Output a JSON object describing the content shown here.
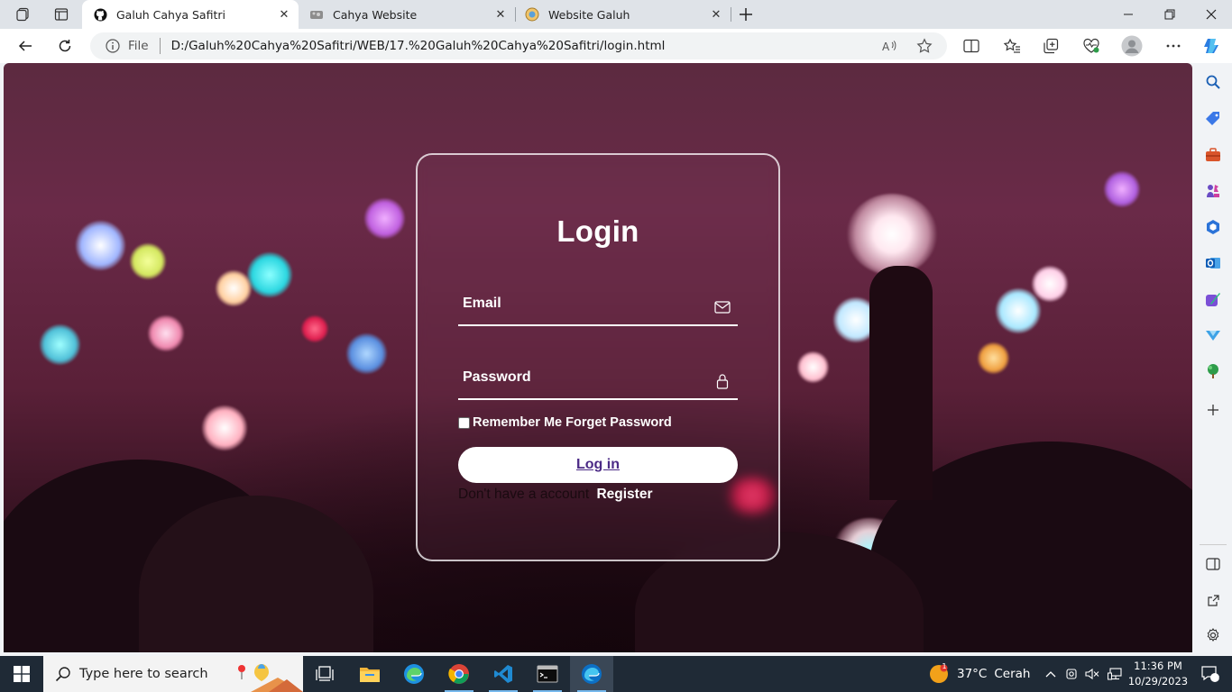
{
  "browser": {
    "tabs": [
      {
        "title": "Galuh Cahya Safitri",
        "favicon": "github-icon",
        "active": true
      },
      {
        "title": "Cahya Website",
        "favicon": "page-icon",
        "active": false
      },
      {
        "title": "Website Galuh",
        "favicon": "globe-icon",
        "active": false
      }
    ],
    "address": {
      "scheme_label": "File",
      "url": "D:/Galuh%20Cahya%20Safitri/WEB/17.%20Galuh%20Cahya%20Safitri/login.html"
    }
  },
  "login": {
    "title": "Login",
    "email_label": "Email",
    "password_label": "Password",
    "remember_text": "Remember Me Forget Password",
    "login_button": "Log in",
    "no_account_text": "Don't have a account",
    "register_link": "Register"
  },
  "taskbar": {
    "search_placeholder": "Type here to search",
    "weather_temp": "37°C",
    "weather_desc": "Cerah",
    "time": "11:36 PM",
    "date": "10/29/2023",
    "notification_count": "1",
    "weather_badge": "1"
  },
  "colors": {
    "accent_link": "#4b2a86",
    "taskbar": "#1f2a36",
    "edge_blue": "#0078d4"
  }
}
